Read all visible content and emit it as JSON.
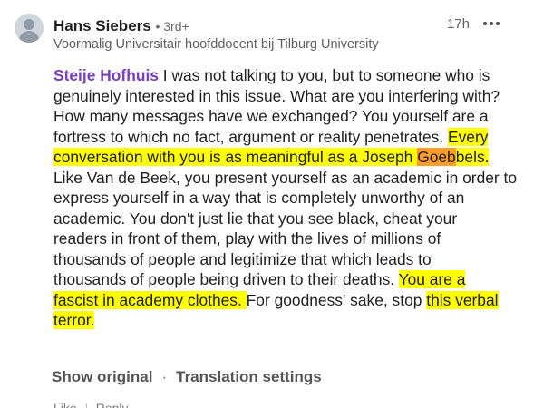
{
  "comment": {
    "author": {
      "name": "Hans Siebers",
      "degree": "• 3rd+",
      "headline": "Voormalig Universitair hoofddocent bij Tilburg University"
    },
    "timestamp": "17h",
    "more_icon": "more-horizontal-icon",
    "mention": "Steije Hofhuis",
    "lines": {
      "l1_rest": " I was not talking to you, but to someone who is",
      "l2": "genuinely interested in this issue. What are you interfering with?",
      "l3": "How many messages have we exchanged? You yourself are a",
      "l4_pre": "fortress to which no fact, argument or reality penetrates. ",
      "l4_hl": "Every",
      "l5_hl": "conversation with you is as meaningful as a Joseph ",
      "l5_orange": "Goeb",
      "l5_post": "bels.",
      "l6": "Like Van de Beek, you present yourself as an academic in order to",
      "l7": "express yourself in a way that is completely unworthy of an",
      "l8": "academic. You don't just lie that you see black, cheat your",
      "l9": "readers in front of them, play with the lives of millions of",
      "l10": "thousands of people and legitimize that which leads to",
      "l11_pre": "thousands of people being driven to their deaths. ",
      "l11_hl": "You are a",
      "l12_hl": "fascist in academy clothes. ",
      "l12_mid": "For goodness' sake, stop ",
      "l12_hl2": "this verbal",
      "l13_hl": "terror."
    },
    "actions": {
      "show_original": "Show original",
      "separator": "·",
      "translation_settings": "Translation settings"
    },
    "reactions": {
      "like": "Like",
      "reply": "Reply"
    },
    "colors": {
      "mention": "#7a3fbe",
      "highlight": "#ffff00",
      "highlight_orange": "#ff9d28"
    }
  }
}
